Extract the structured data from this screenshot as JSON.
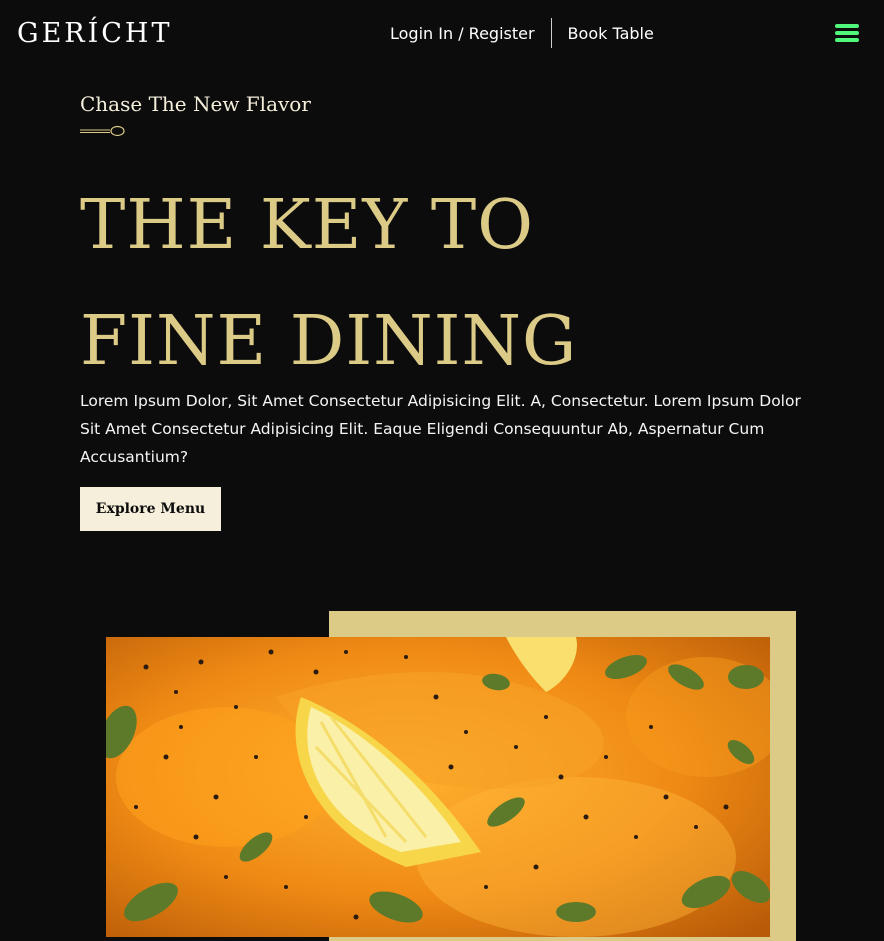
{
  "navbar": {
    "logo": "GERÍCHT",
    "links": [
      "Login In / Register",
      "Book Table"
    ],
    "menu_icon": "hamburger-icon",
    "menu_color": "#4ff77a"
  },
  "hero": {
    "subtitle": "Chase The New Flavor",
    "heading_lines": [
      "THE KEY TO",
      "FINE DINING"
    ],
    "description": "Lorem Ipsum Dolor, Sit Amet Consectetur Adipisicing Elit. A, Consectetur. Lorem Ipsum Dolor Sit Amet Consectetur Adipisicing Elit. Eaque Eligendi Consequuntur Ab, Aspernatur Cum Accusantium?",
    "button_label": "Explore Menu",
    "image_icon": "food-dish-image"
  },
  "colors": {
    "background": "#0c0c0c",
    "gold": "#dcca87",
    "cream": "#f5efdb",
    "white": "#ffffff"
  }
}
